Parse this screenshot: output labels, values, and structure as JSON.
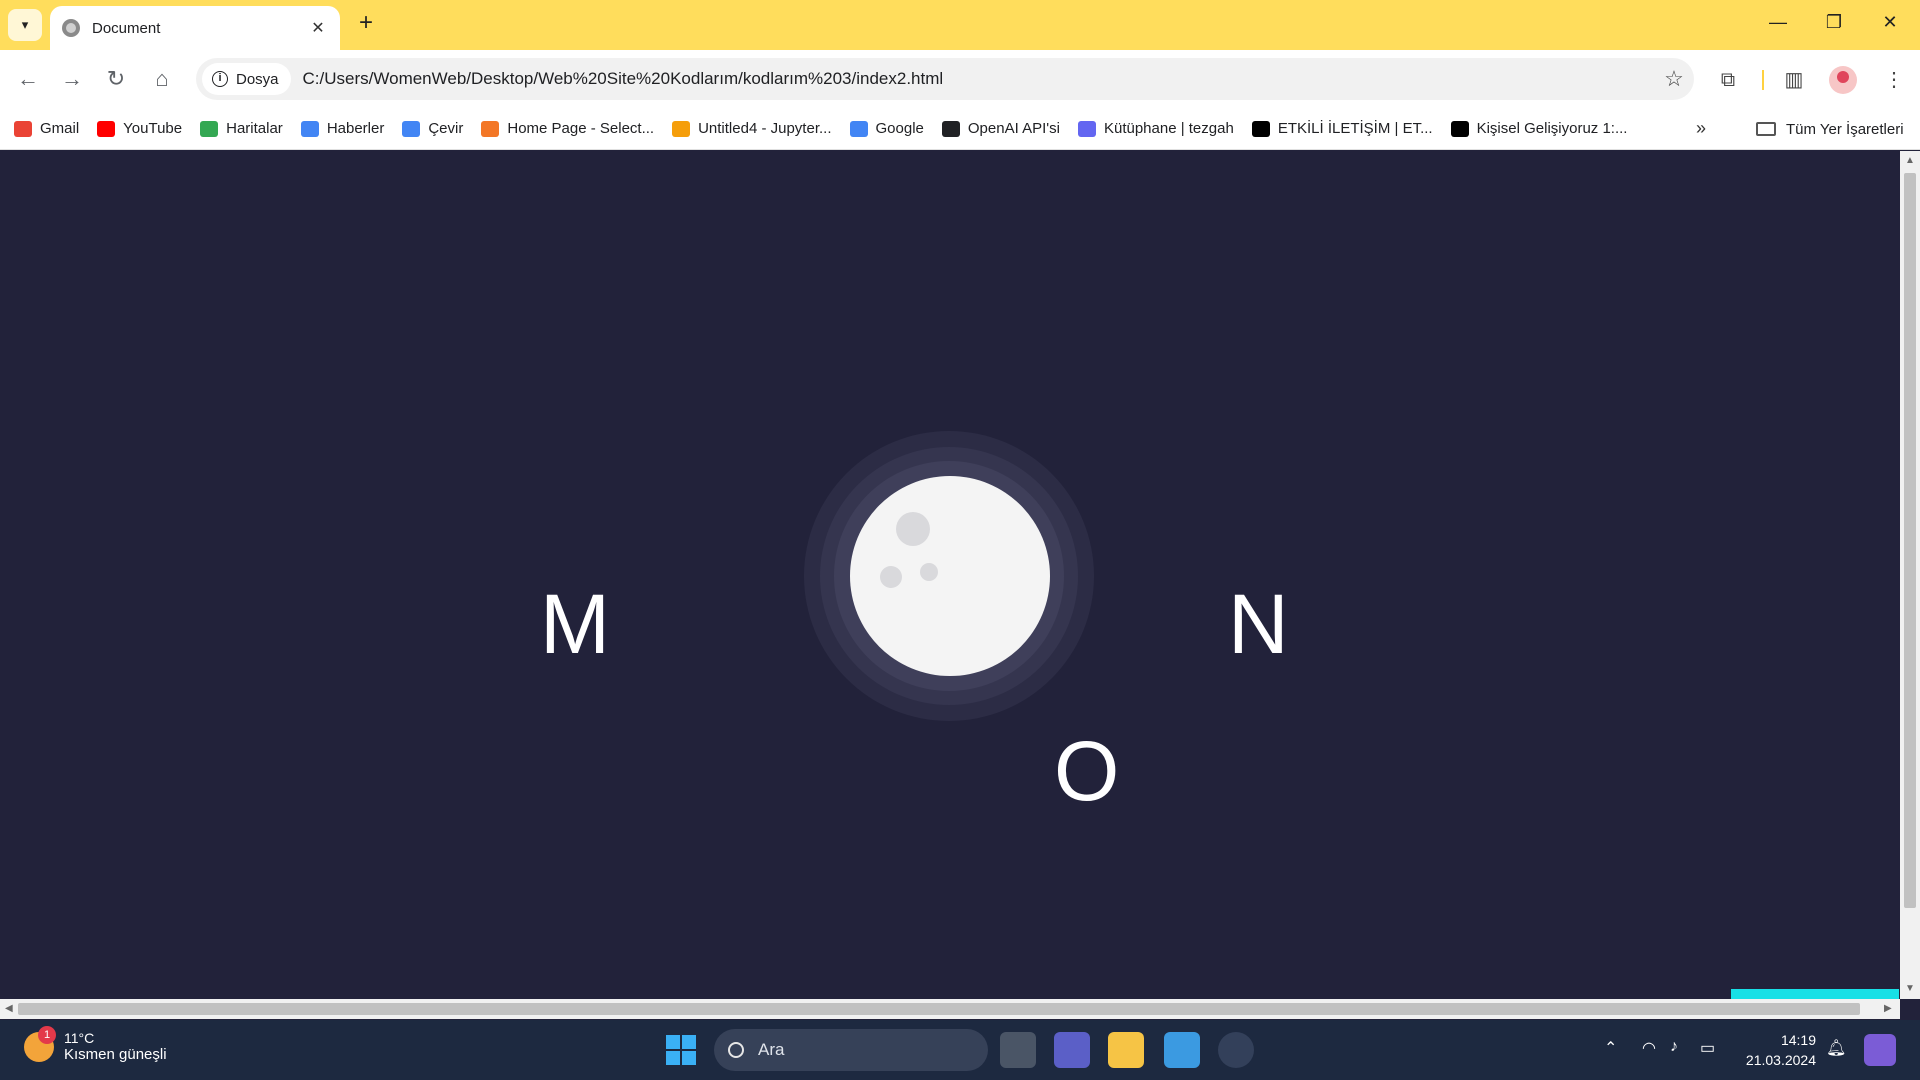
{
  "browser": {
    "tab_title": "Document",
    "new_tab_symbol": "+",
    "chip_label": "Dosya",
    "url": "C:/Users/WomenWeb/Desktop/Web%20Site%20Kodlarım/kodlarım%203/index2.html",
    "bookmarks": [
      {
        "label": "Gmail",
        "icon": "gmail-icon",
        "color": "#ea4335"
      },
      {
        "label": "YouTube",
        "icon": "youtube-icon",
        "color": "#ff0000"
      },
      {
        "label": "Haritalar",
        "icon": "maps-icon",
        "color": "#34a853"
      },
      {
        "label": "Haberler",
        "icon": "news-icon",
        "color": "#4285f4"
      },
      {
        "label": "Çevir",
        "icon": "translate-icon",
        "color": "#4285f4"
      },
      {
        "label": "Home Page - Select...",
        "icon": "jupyter-icon",
        "color": "#f37726"
      },
      {
        "label": "Untitled4 - Jupyter...",
        "icon": "notebook-icon",
        "color": "#f59e0b"
      },
      {
        "label": "Google",
        "icon": "google-icon",
        "color": "#4285f4"
      },
      {
        "label": "OpenAI API'si",
        "icon": "openai-icon",
        "color": "#202124"
      },
      {
        "label": "Kütüphane | tezgah",
        "icon": "library-icon",
        "color": "#6366f1"
      },
      {
        "label": "ETKİLİ İLETİŞİM | ET...",
        "icon": "medium-icon",
        "color": "#000000"
      },
      {
        "label": "Kişisel Gelişiyoruz 1:...",
        "icon": "medium-icon",
        "color": "#000000"
      }
    ],
    "all_bookmarks_label": "Tüm Yer İşaretleri",
    "more_symbol": "»"
  },
  "page": {
    "letters": {
      "m": "M",
      "n": "N",
      "o": "O"
    },
    "colors": {
      "background": "#22223a",
      "moon": "#f4f4f4",
      "accent": "#18e0e6"
    }
  },
  "taskbar": {
    "temperature": "11°C",
    "weather_desc": "Kısmen güneşli",
    "weather_badge": "1",
    "search_placeholder": "Ara",
    "time": "14:19",
    "date": "21.03.2024"
  }
}
